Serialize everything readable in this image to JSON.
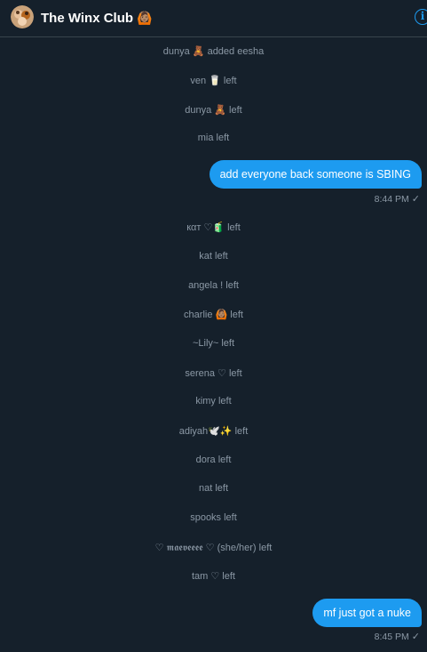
{
  "header": {
    "title": "The Winx Club",
    "title_emoji": "🙆🏽",
    "info_icon": "i"
  },
  "system_messages": [
    {
      "text": "dunya 🧸 added eesha"
    },
    {
      "text": "ven 🥛 left"
    },
    {
      "text": "dunya 🧸 left"
    },
    {
      "text": "mia left"
    },
    {
      "text": "кαт ♡🧃 left"
    },
    {
      "text": "kat left"
    },
    {
      "text": "angela ! left"
    },
    {
      "text": "charlie 🙆🏽 left"
    },
    {
      "text": "~Lily~ left"
    },
    {
      "text": "serena ♡ left"
    },
    {
      "text": "kimy left"
    },
    {
      "text": "adiyah🕊️✨ left"
    },
    {
      "text": "dora left"
    },
    {
      "text": "nat left"
    },
    {
      "text": "spooks left"
    },
    {
      "text": "♡ 𝖒𝖆𝖊𝖛𝖊𝖊𝖊𝖊 ♡ (she/her) left"
    },
    {
      "text": "tam ♡ left"
    }
  ],
  "outgoing_messages": [
    {
      "text": "add everyone back someone is SBING",
      "time": "8:44 PM",
      "status": "✓"
    },
    {
      "text": "mf just got a nuke",
      "time": "8:45 PM",
      "status": "✓"
    }
  ],
  "colors": {
    "background": "#15202b",
    "bubble": "#1d9bf0",
    "system_text": "#8b98a5",
    "accent": "#1d9bf0"
  }
}
